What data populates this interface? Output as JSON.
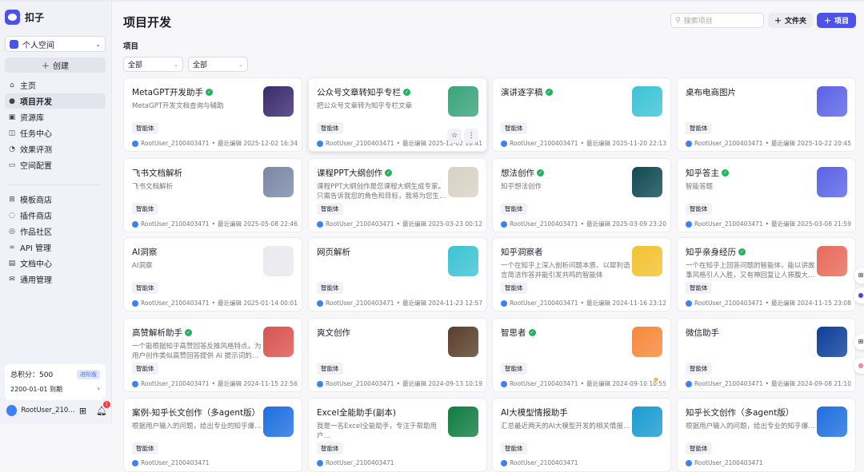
{
  "app": {
    "name": "扣子"
  },
  "sidebar": {
    "space": "个人空间",
    "create": "创建",
    "nav": [
      {
        "label": "主页",
        "icon": "home-icon",
        "g": "⌂"
      },
      {
        "label": "项目开发",
        "icon": "robot-icon",
        "g": "●",
        "active": true
      },
      {
        "label": "资源库",
        "icon": "library-icon",
        "g": "▣"
      },
      {
        "label": "任务中心",
        "icon": "task-icon",
        "g": "◫"
      },
      {
        "label": "效果评测",
        "icon": "gauge-icon",
        "g": "◔"
      },
      {
        "label": "空间配置",
        "icon": "terminal-icon",
        "g": "▭"
      }
    ],
    "nav2": [
      {
        "label": "模板商店",
        "icon": "template-icon",
        "g": "⊞"
      },
      {
        "label": "插件商店",
        "icon": "plugin-icon",
        "g": "◌"
      },
      {
        "label": "作品社区",
        "icon": "community-icon",
        "g": "◎"
      },
      {
        "label": "API 管理",
        "icon": "api-icon",
        "g": "∞"
      },
      {
        "label": "文档中心",
        "icon": "doc-icon",
        "g": "▤"
      },
      {
        "label": "通用管理",
        "icon": "settings-icon",
        "g": "✉"
      }
    ],
    "points": {
      "label": "总积分：500",
      "badge": "进阶版",
      "expire": "2200-01-01 到期"
    },
    "user": {
      "name": "RootUser_210…",
      "notifications": "1"
    }
  },
  "header": {
    "title": "项目开发",
    "section": "项目",
    "filters": [
      "全部",
      "全部"
    ],
    "search_placeholder": "搜索项目",
    "folder_btn": "文件夹",
    "project_btn": "项目"
  },
  "cards": [
    {
      "name": "MetaGPT开发助手",
      "verified": true,
      "desc": "MetaGPT开发文档查询与辅助",
      "tag": "智能体",
      "user": "RootUser_2100403471",
      "edited": "最近编辑 2025-12-02 16:34",
      "color": "#3a2a6e"
    },
    {
      "name": "公众号文章转知乎专栏",
      "verified": true,
      "desc": "把公众号文章转为知乎专栏文章",
      "tag": "智能体",
      "user": "RootUser_2100403471",
      "edited": "最近编辑 2025-12-02 16:41",
      "color": "#3aa37a",
      "hover": true
    },
    {
      "name": "演讲逐字稿",
      "verified": true,
      "desc": "",
      "tag": "智能体",
      "user": "RootUser_2100403471",
      "edited": "最近编辑 2025-11-20 22:13",
      "color": "#3cc3d4"
    },
    {
      "name": "桌布电商图片",
      "verified": false,
      "desc": "",
      "tag": "智能体",
      "user": "RootUser_2100403471",
      "edited": "最近编辑 2025-10-22 20:45",
      "color": "#5a63e6"
    },
    {
      "name": "飞书文档解析",
      "verified": false,
      "desc": "飞书文档解析",
      "tag": "智能体",
      "user": "RootUser_2100403471",
      "edited": "最近编辑 2025-05-08 22:46",
      "color": "#7a88a6"
    },
    {
      "name": "课程PPT大纲创作",
      "verified": true,
      "desc": "课程PPT大纲创作是您课程大纲生成专家。只需告诉我您的角色和目标，我将为您生…",
      "tag": "智能体",
      "user": "RootUser_2100403471",
      "edited": "最近编辑 2025-03-23 00:12",
      "color": "#d8d2c4"
    },
    {
      "name": "想法创作",
      "verified": true,
      "desc": "知乎想法创作",
      "tag": "智能体",
      "user": "RootUser_2100403471",
      "edited": "最近编辑 2025-03-09 23:20",
      "color": "#0f4a52"
    },
    {
      "name": "知乎答主",
      "verified": true,
      "desc": "智能答题",
      "tag": "智能体",
      "user": "RootUser_2100403471",
      "edited": "最近编辑 2025-03-08 21:59",
      "color": "#5a63e6"
    },
    {
      "name": "AI洞察",
      "verified": false,
      "desc": "AI洞察",
      "tag": "智能体",
      "user": "RootUser_2100403471",
      "edited": "最近编辑 2025-01-14 00:01",
      "color": "#e9e9ee"
    },
    {
      "name": "网页解析",
      "verified": false,
      "desc": "",
      "tag": "智能体",
      "user": "RootUser_2100403471",
      "edited": "最近编辑 2024-11-23 12:57",
      "color": "#3cc3d4"
    },
    {
      "name": "知乎洞察者",
      "verified": false,
      "desc": "一个在知乎上深入剖析问题本质、以犀利语言简洁作答并能引发共鸣的智能体",
      "tag": "智能体",
      "user": "RootUser_2100403471",
      "edited": "最近编辑 2024-11-16 23:12",
      "color": "#f2c230"
    },
    {
      "name": "知乎亲身经历",
      "verified": true,
      "desc": "一个在知乎上回答问题的智能体，能以讲故事风格引人入胜，又有神回复让人捧腹大…",
      "tag": "智能体",
      "user": "RootUser_2100403471",
      "edited": "最近编辑 2024-11-15 23:08",
      "color": "#e86a5a"
    },
    {
      "name": "高赞解析助手",
      "verified": true,
      "desc": "一个能根据知乎高赞回答反推风格特点，为用户创作类似高赞回答提供 AI 提示词的…",
      "tag": "智能体",
      "user": "RootUser_2100403471",
      "edited": "最近编辑 2024-11-15 22:56",
      "color": "#d9534f"
    },
    {
      "name": "爽文创作",
      "verified": false,
      "desc": "",
      "tag": "智能体",
      "user": "RootUser_2100403471",
      "edited": "最近编辑 2024-09-13 10:19",
      "color": "#5a3e2b"
    },
    {
      "name": "智思者",
      "verified": true,
      "desc": "",
      "tag": "智能体",
      "user": "RootUser_2100403471",
      "edited": "最近编辑 2024-09-10 10:55",
      "color": "#f5883a",
      "starred": true
    },
    {
      "name": "微信助手",
      "verified": false,
      "desc": "",
      "tag": "智能体",
      "user": "RootUser_2100403471",
      "edited": "最近编辑 2024-09-08 21:10",
      "color": "#0d3f9a"
    },
    {
      "name": "案例-知乎长文创作（多agent版）",
      "verified": false,
      "desc": "根据用户输入的问题，给出专业的知乎爆…",
      "tag": "智能体",
      "user": "RootUser_2100403471",
      "edited": "",
      "color": "#1e6fe0"
    },
    {
      "name": "Excel全能助手(副本)",
      "verified": false,
      "desc": "我是一名Excel全能助手，专注于帮助用户…",
      "tag": "智能体",
      "user": "RootUser_2100403471",
      "edited": "",
      "color": "#107c41"
    },
    {
      "name": "AI大模型情报助手",
      "verified": false,
      "desc": "汇总最近两天的AI大模型开发的相关情报…",
      "tag": "智能体",
      "user": "RootUser_2100403471",
      "edited": "",
      "color": "#1a9bd0"
    },
    {
      "name": "知乎长文创作（多agent版）",
      "verified": false,
      "desc": "根据用户输入的问题，给出专业的知乎爆…",
      "tag": "智能体",
      "user": "RootUser_2100403471",
      "edited": "",
      "color": "#1e6fe0"
    }
  ]
}
